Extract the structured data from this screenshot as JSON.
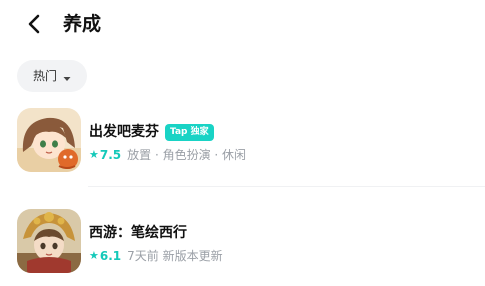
{
  "header": {
    "title": "养成",
    "back_icon": "chevron-left-icon"
  },
  "filter": {
    "label": "热门",
    "icon": "caret-down-icon"
  },
  "games": [
    {
      "name": "出发吧麦芬",
      "badge": "Tap 独家",
      "star": "★",
      "rating": "7.5",
      "meta": "放置 · 角色扮演 · 休闲"
    },
    {
      "name": "西游：笔绘西行",
      "star": "★",
      "rating": "6.1",
      "meta": "7天前 新版本更新"
    }
  ],
  "colors": {
    "accent": "#19d3c5",
    "rating": "#14c9b9",
    "chip_bg": "#f2f3f5"
  }
}
